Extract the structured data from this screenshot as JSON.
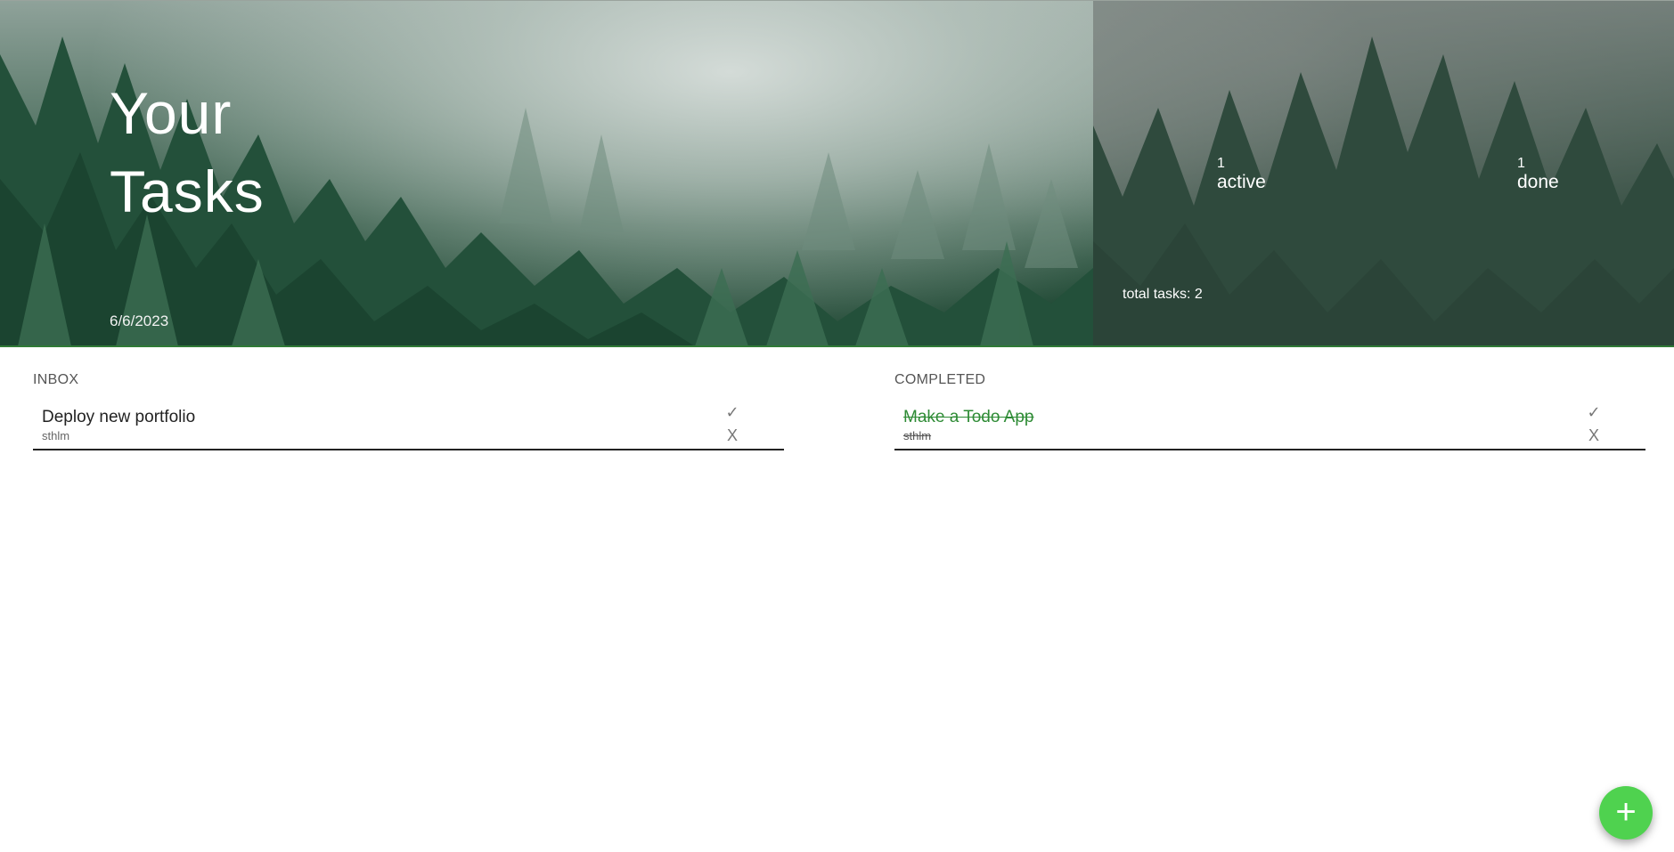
{
  "header": {
    "title_line1": "Your",
    "title_line2": "Tasks",
    "date": "6/6/2023",
    "stats": {
      "active_count": "1",
      "active_label": "active",
      "done_count": "1",
      "done_label": "done",
      "total": "total tasks: 2"
    }
  },
  "inbox": {
    "title": "INBOX",
    "tasks": [
      {
        "title": "Deploy new portfolio",
        "location": "sthlm",
        "complete_icon": "✓",
        "delete_icon": "X"
      }
    ]
  },
  "completed": {
    "title": "COMPLETED",
    "tasks": [
      {
        "title": "Make a Todo App",
        "location": "sthlm",
        "complete_icon": "✓",
        "delete_icon": "X"
      }
    ]
  },
  "fab": {
    "label": "+",
    "icon": "plus-icon"
  },
  "colors": {
    "accent": "#4fd24f",
    "done_text": "#2e8b35",
    "divider": "#222222",
    "hero_border": "#2f7a36"
  }
}
